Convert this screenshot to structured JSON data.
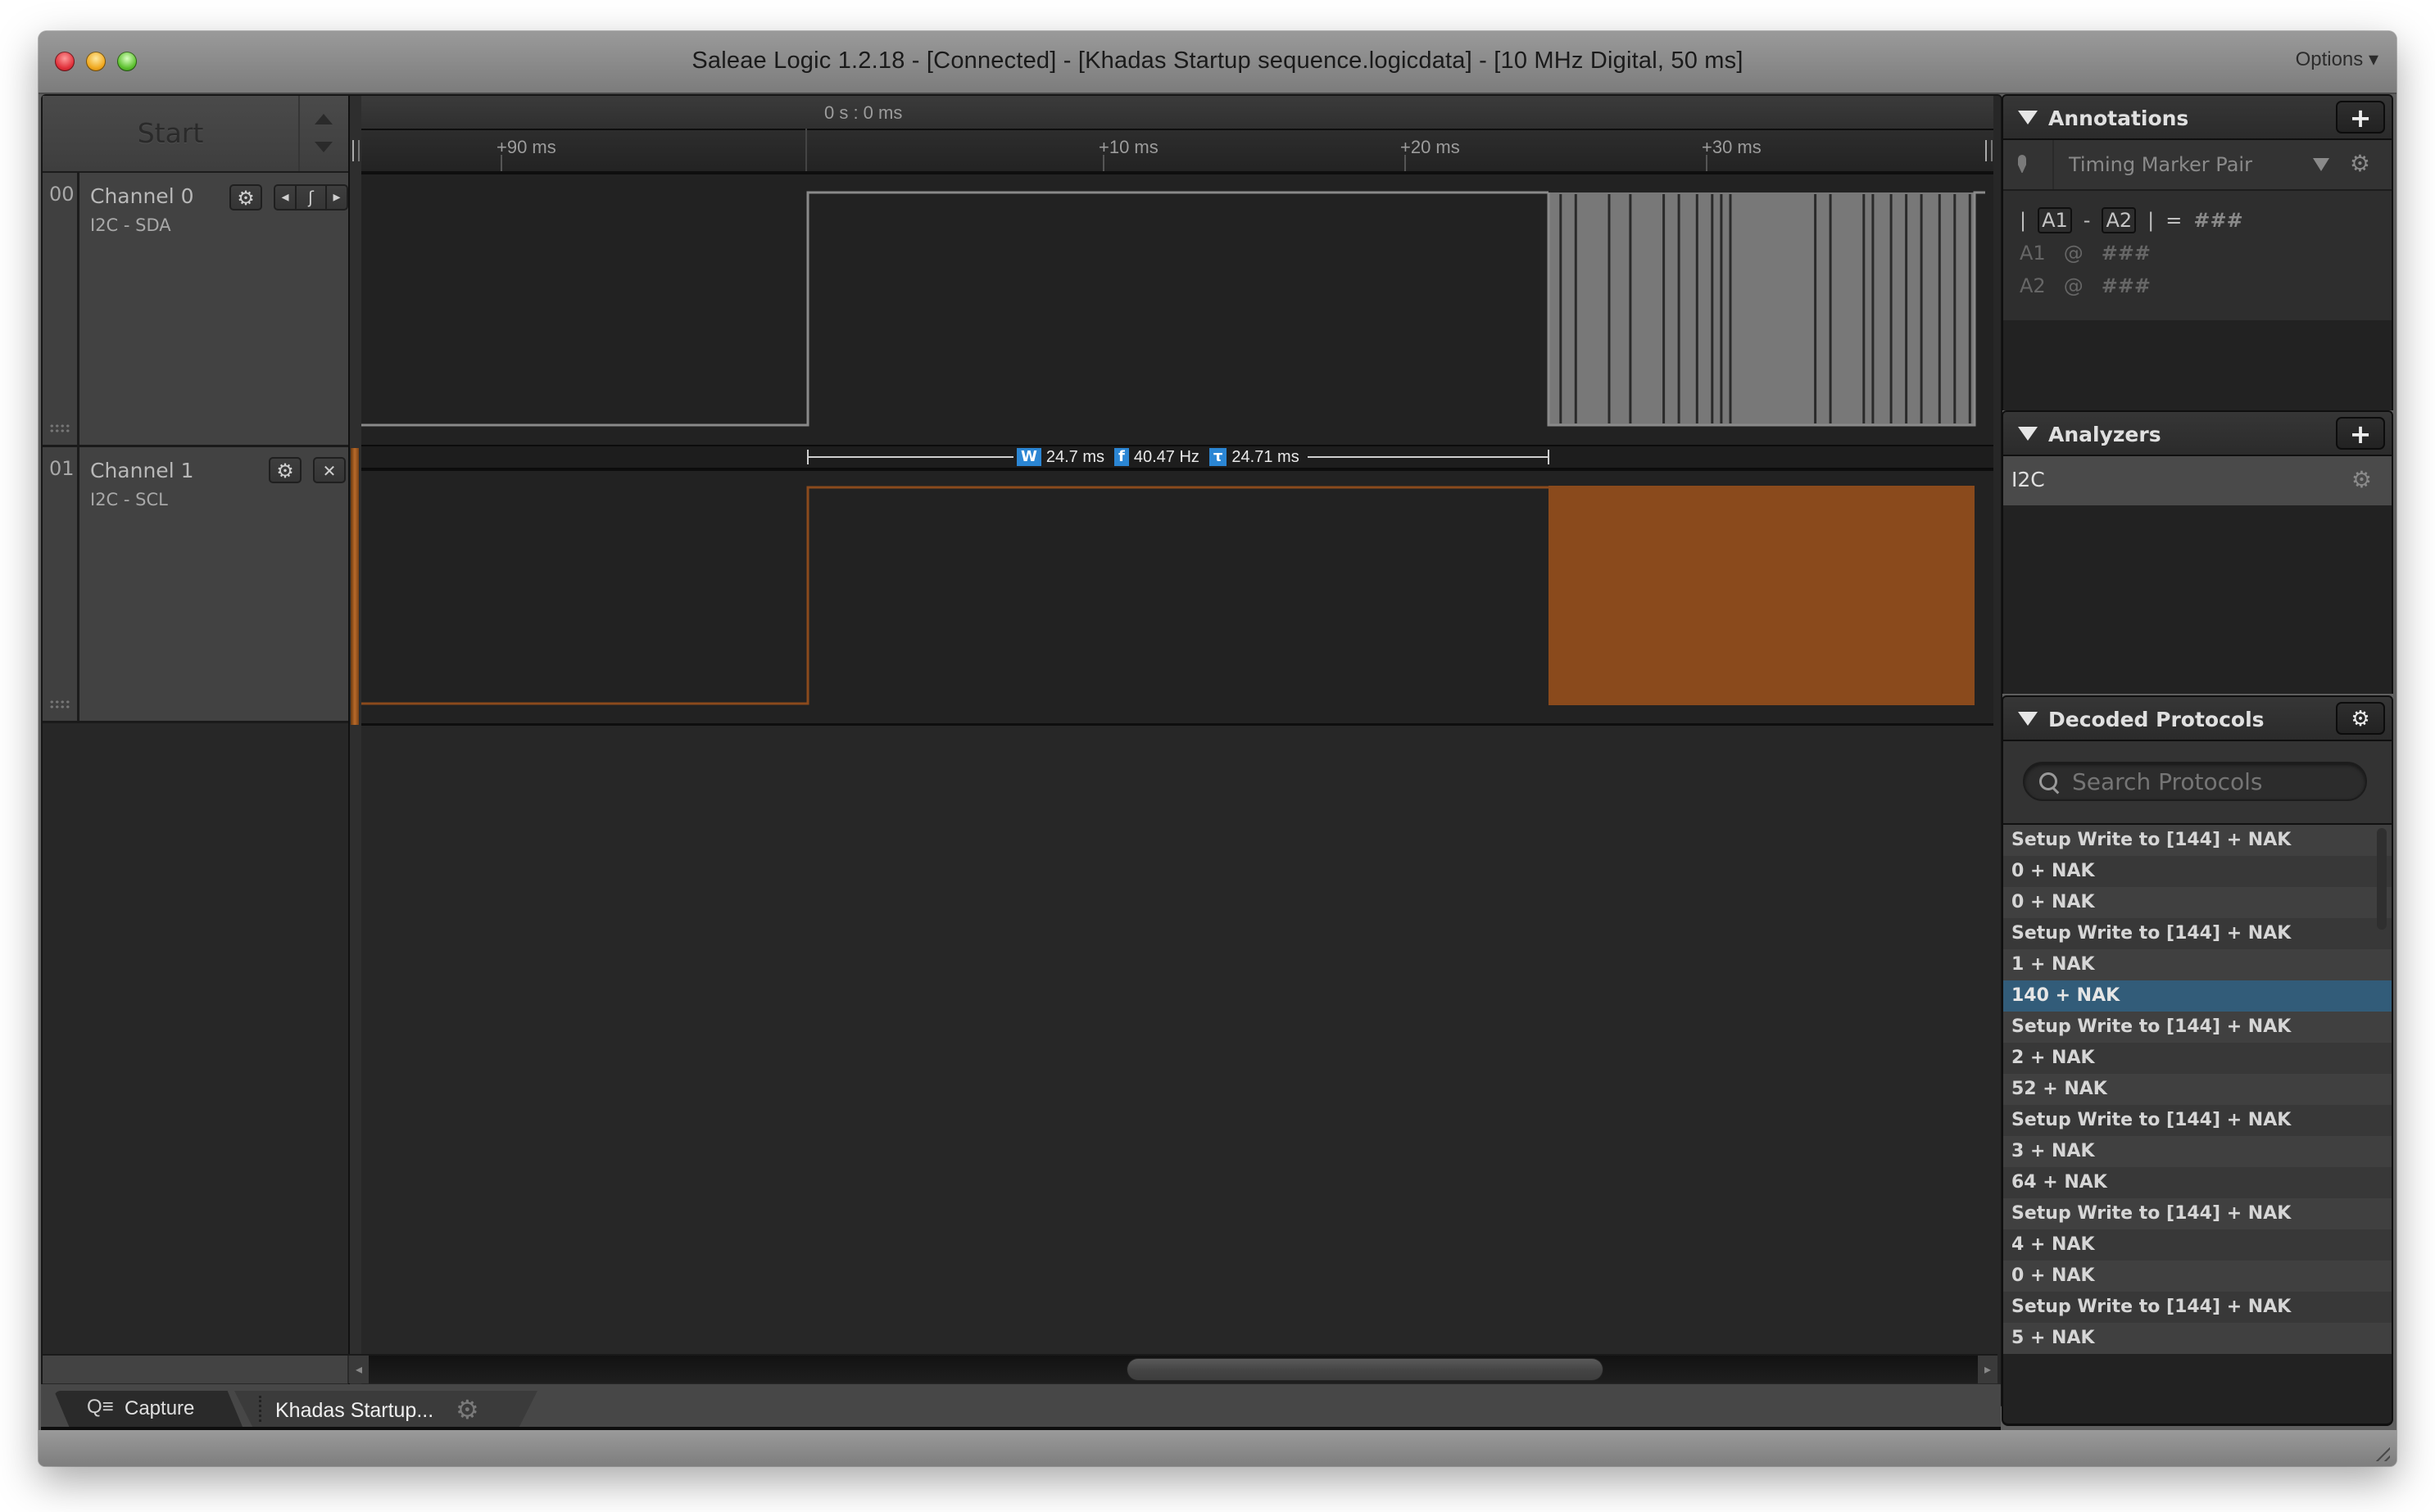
{
  "window": {
    "title": "Saleae Logic 1.2.18 - [Connected] - [Khadas Startup sequence.logicdata] - [10 MHz Digital, 50 ms]",
    "options_label": "Options ▾"
  },
  "toolbar": {
    "start_label": "Start"
  },
  "ruler": {
    "origin_label": "0 s : 0 ms",
    "ticks": [
      "+90 ms",
      "+10 ms",
      "+20 ms",
      "+30 ms"
    ]
  },
  "channels": [
    {
      "number": "00",
      "name": "Channel 0",
      "protocol_label": "I2C - SDA",
      "color": "#8a8a8a",
      "fill": "#787878"
    },
    {
      "number": "01",
      "name": "Channel 1",
      "protocol_label": "I2C - SCL",
      "color": "#8b4a1c",
      "fill": "#8a4a1c"
    }
  ],
  "channel_buttons": {
    "settings_icon": "⚙",
    "prev_edge": "◂",
    "edge_trigger": "ʃ",
    "next_edge": "▸",
    "close_icon": "✕"
  },
  "measurement": {
    "width_badge": "W",
    "width_value": "24.7 ms",
    "freq_badge": "f",
    "freq_value": "40.47 Hz",
    "period_badge": "τ",
    "period_value": "24.71 ms"
  },
  "tabs": {
    "capture_label": "Capture",
    "file_label": "Khadas Startup..."
  },
  "panels": {
    "annotations": {
      "title": "Annotations",
      "add_icon": "+",
      "marker_type": "Timing Marker Pair",
      "equation": {
        "left_bar": "|",
        "a1": "A1",
        "minus": "-",
        "a2": "A2",
        "right_bar": "|",
        "equals": "=",
        "value": "###"
      },
      "markers": [
        {
          "name": "A1",
          "at": "@",
          "value": "###"
        },
        {
          "name": "A2",
          "at": "@",
          "value": "###"
        }
      ]
    },
    "analyzers": {
      "title": "Analyzers",
      "add_icon": "+",
      "items": [
        {
          "name": "I2C"
        }
      ]
    },
    "decoded_protocols": {
      "title": "Decoded Protocols",
      "search_placeholder": "Search Protocols",
      "selected_index": 5,
      "items": [
        "Setup Write to [144] + NAK",
        "0 + NAK",
        "0 + NAK",
        "Setup Write to [144] + NAK",
        "1 + NAK",
        "140 + NAK",
        "Setup Write to [144] + NAK",
        "2 + NAK",
        "52 + NAK",
        "Setup Write to [144] + NAK",
        "3 + NAK",
        "64 + NAK",
        "Setup Write to [144] + NAK",
        "4 + NAK",
        "0 + NAK",
        "Setup Write to [144] + NAK",
        "5 + NAK"
      ]
    }
  },
  "colors": {
    "accent_blue": "#2b86d4",
    "selected_row": "#325c79",
    "channel1_orange": "#8a4a1c"
  }
}
